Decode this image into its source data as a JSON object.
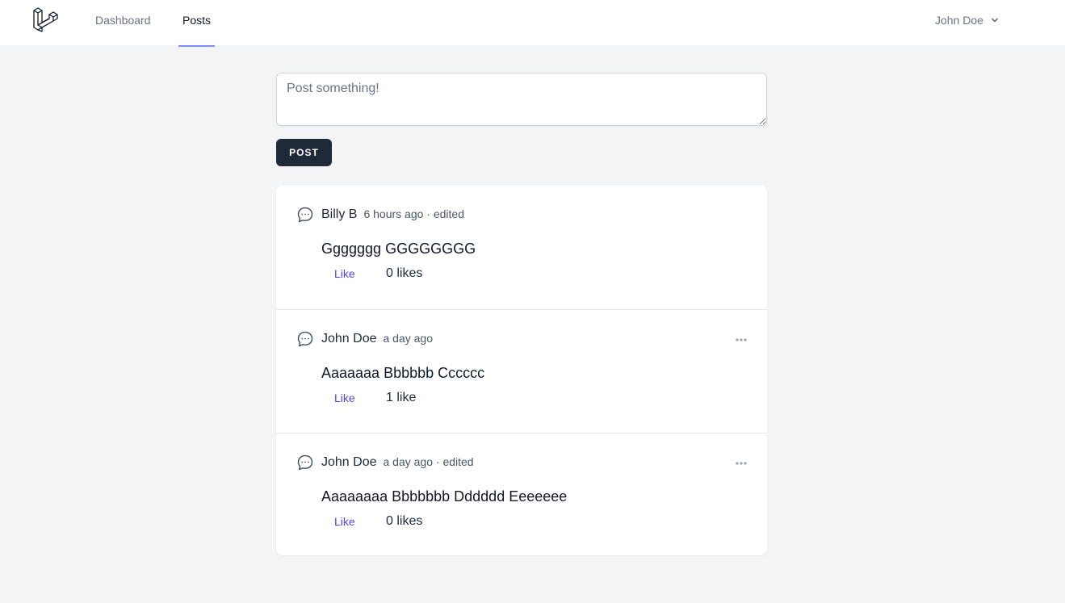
{
  "nav": {
    "links": [
      {
        "label": "Dashboard",
        "active": false
      },
      {
        "label": "Posts",
        "active": true
      }
    ],
    "user_name": "John Doe"
  },
  "compose": {
    "placeholder": "Post something!",
    "value": "",
    "submit_label": "POST"
  },
  "posts": [
    {
      "author": "Billy B",
      "meta": "6 hours ago · edited",
      "body": "Ggggggg GGGGGGGG",
      "like_label": "Like",
      "likes": "0 likes",
      "has_menu": false
    },
    {
      "author": "John Doe",
      "meta": "a day ago",
      "body": "Aaaaaaa Bbbbbb Cccccc",
      "like_label": "Like",
      "likes": "1 like",
      "has_menu": true
    },
    {
      "author": "John Doe",
      "meta": "a day ago · edited",
      "body": "Aaaaaaaa Bbbbbbb Dddddd Eeeeeee",
      "like_label": "Like",
      "likes": "0 likes",
      "has_menu": true
    }
  ],
  "icons": {
    "logo": "laravel-logo-icon",
    "user_chevron": "chevron-down-icon",
    "post": "chat-bubble-icon",
    "post_menu": "ellipsis-icon"
  },
  "colors": {
    "accent": "#4f46e5",
    "nav_underline": "#818cf8",
    "button_bg": "#1f2937",
    "page_bg": "#f3f4f6"
  }
}
